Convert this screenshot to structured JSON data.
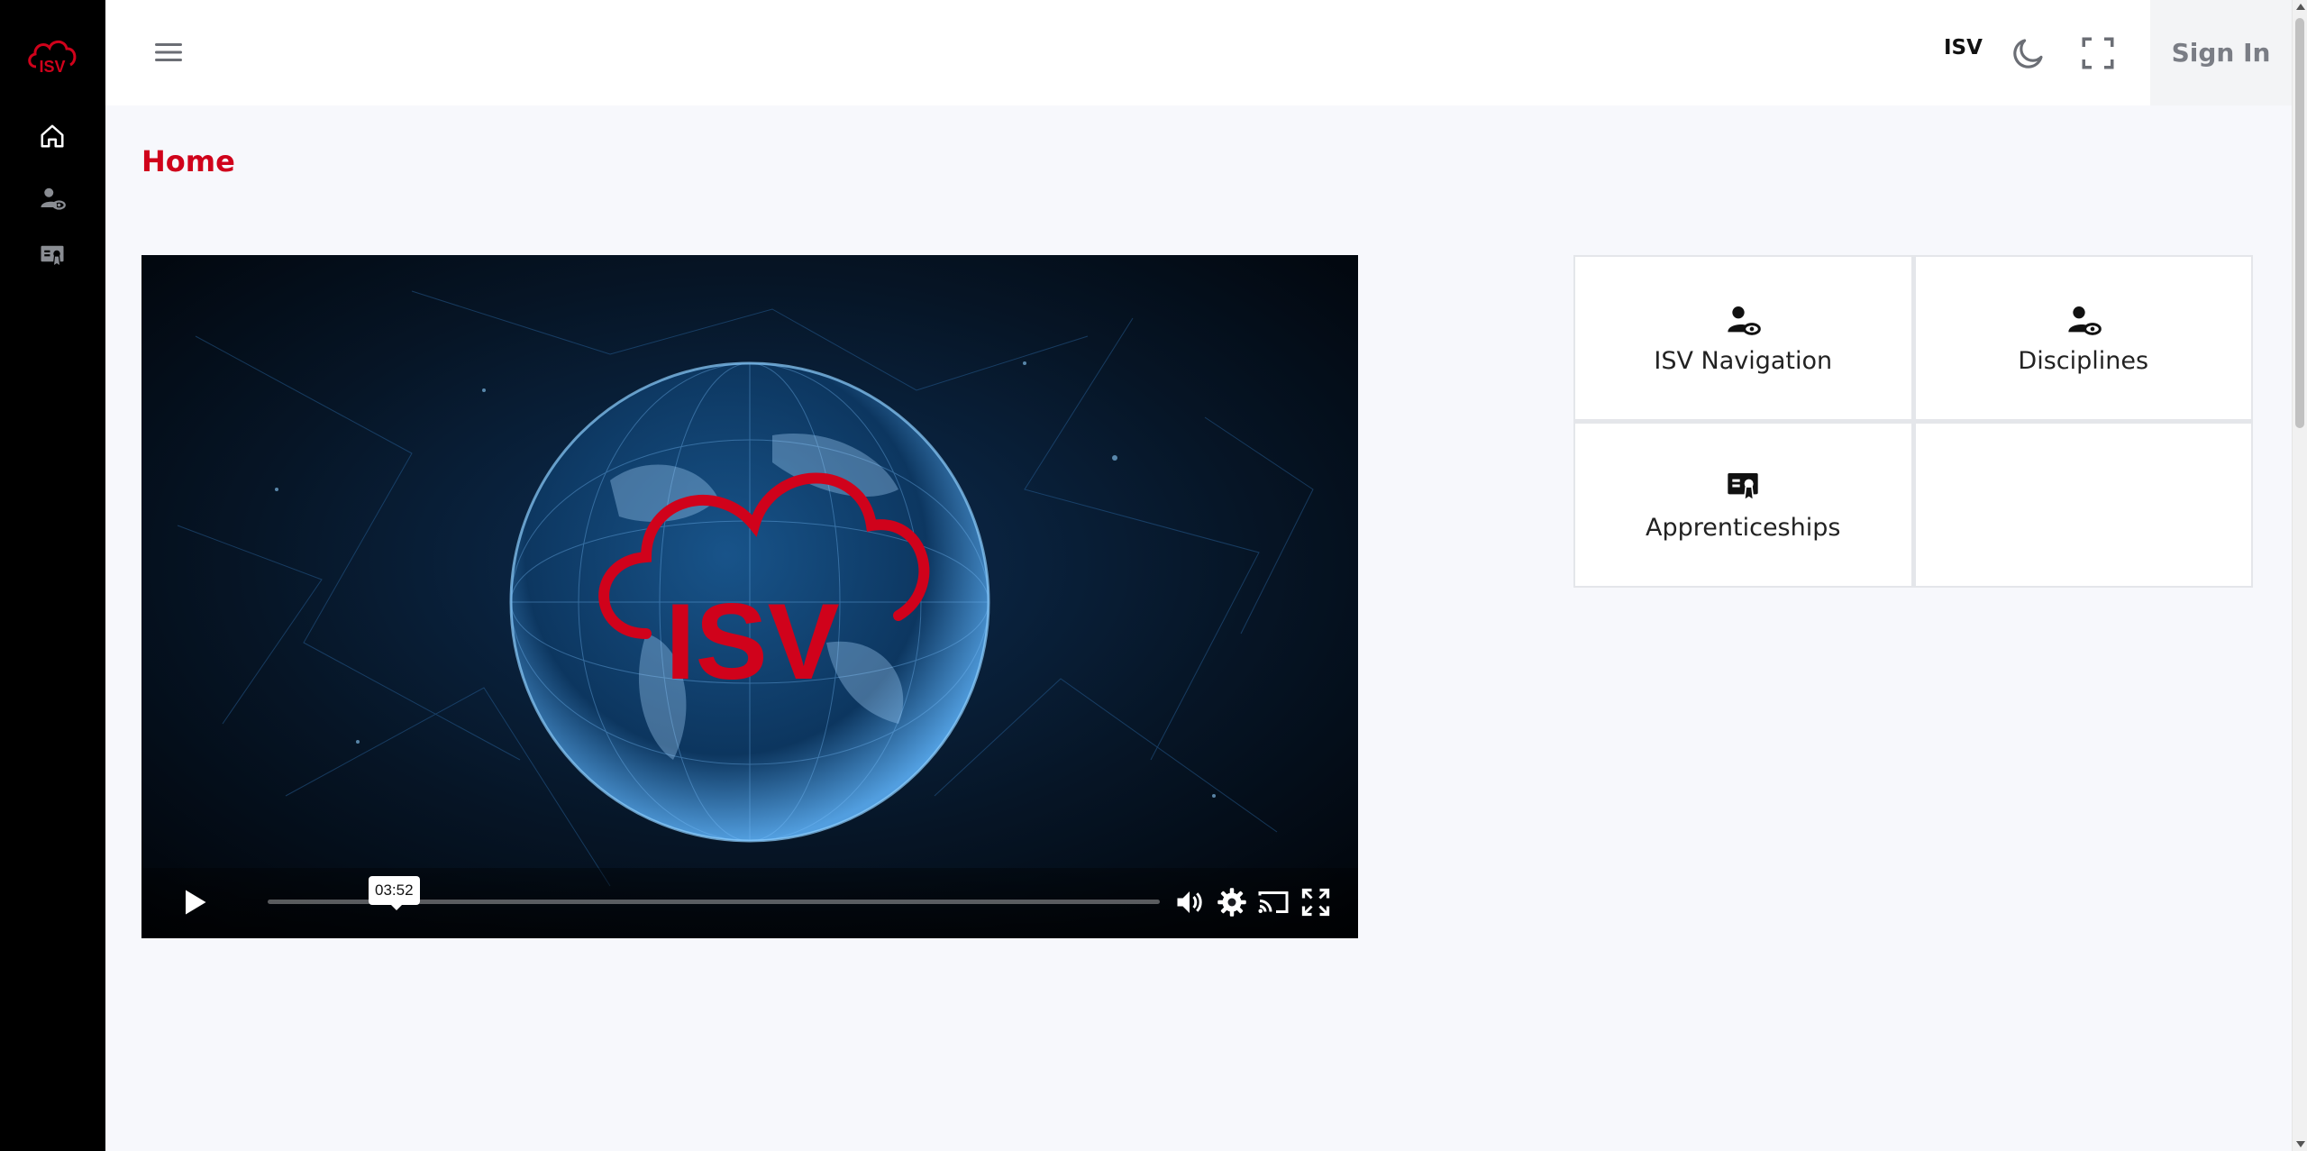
{
  "brand": {
    "logo_text": "ISV",
    "accent_color": "#d0021b"
  },
  "sidebar": {
    "items": [
      {
        "icon": "home-icon",
        "active": true
      },
      {
        "icon": "user-view-icon",
        "active": false
      },
      {
        "icon": "certificate-icon",
        "active": false
      }
    ]
  },
  "topbar": {
    "menu_icon": "hamburger-menu-icon",
    "org_label": "ISV",
    "theme_icon": "moon-icon",
    "fullscreen_icon": "fullscreen-icon",
    "sign_in_label": "Sign In"
  },
  "page": {
    "title": "Home"
  },
  "video": {
    "overlay_logo_text": "ISV",
    "current_time_tooltip": "03:52",
    "progress": 0.0,
    "controls": [
      "play-icon",
      "volume-icon",
      "settings-icon",
      "cast-icon",
      "fullscreen-icon"
    ]
  },
  "tiles": [
    {
      "label": "ISV Navigation",
      "icon": "user-view-icon"
    },
    {
      "label": "Disciplines",
      "icon": "user-view-icon"
    },
    {
      "label": "Apprenticeships",
      "icon": "certificate-icon"
    },
    {
      "label": "",
      "icon": ""
    }
  ]
}
